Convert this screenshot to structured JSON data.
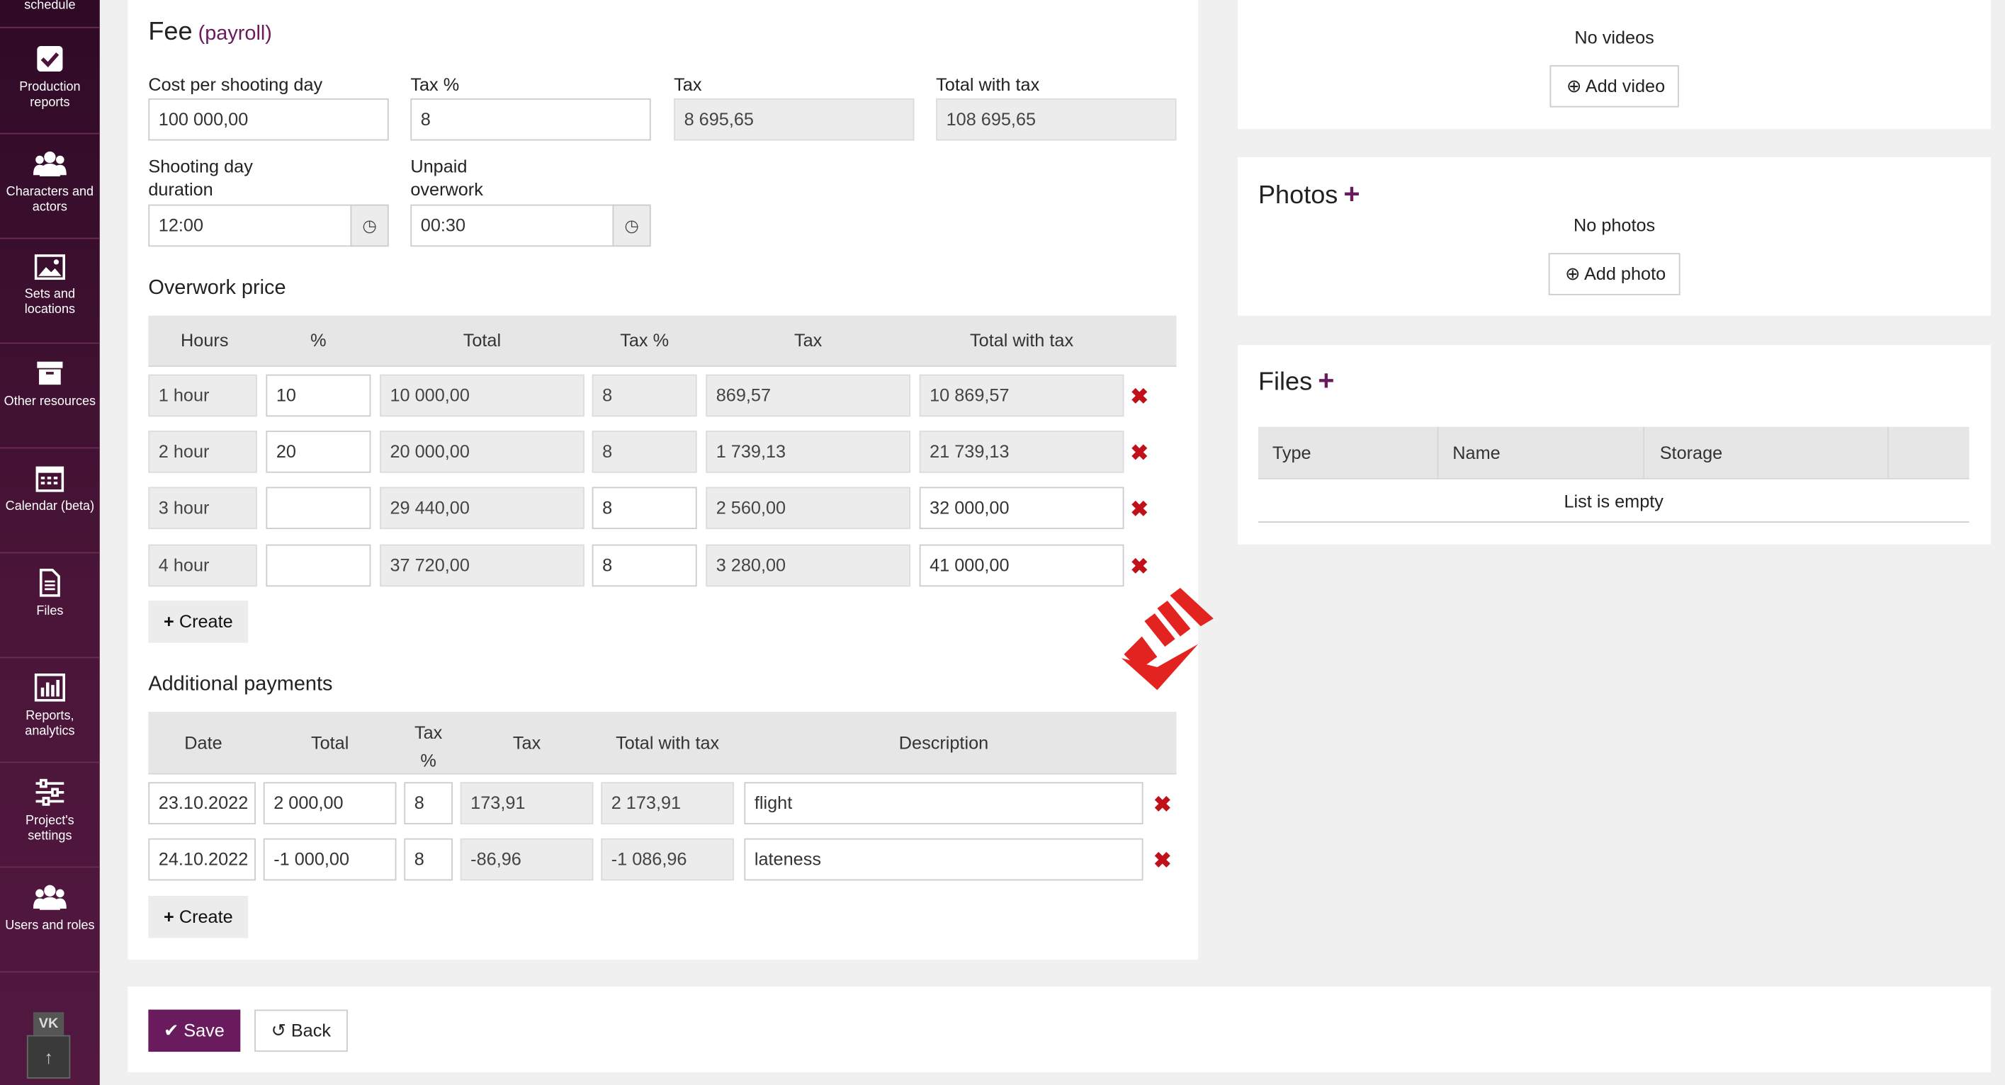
{
  "sidebar": {
    "top_label": "schedule",
    "items": [
      {
        "label": "Production reports",
        "icon": "checkbox-icon"
      },
      {
        "label": "Characters and actors",
        "icon": "users-icon"
      },
      {
        "label": "Sets and locations",
        "icon": "image-icon"
      },
      {
        "label": "Other resources",
        "icon": "archive-icon"
      },
      {
        "label": "Calendar (beta)",
        "icon": "calendar-icon"
      },
      {
        "label": "Files",
        "icon": "document-icon"
      },
      {
        "label": "Reports, analytics",
        "icon": "bar-chart-icon"
      },
      {
        "label": "Project's settings",
        "icon": "sliders-icon"
      },
      {
        "label": "Users and roles",
        "icon": "users-icon"
      }
    ],
    "vk_label": "VK",
    "scroll_top_label": "↑"
  },
  "fee": {
    "title": "Fee",
    "subtitle": "(payroll)",
    "cost_label": "Cost per shooting day",
    "cost_value": "100 000,00",
    "tax_pct_label": "Tax %",
    "tax_pct_value": "8",
    "tax_label": "Tax",
    "tax_value": "8 695,65",
    "total_label": "Total with tax",
    "total_value": "108 695,65",
    "duration_label_1": "Shooting day",
    "duration_label_2": "duration",
    "duration_value": "12:00",
    "unpaid_label_1": "Unpaid",
    "unpaid_label_2": "overwork",
    "unpaid_value": "00:30"
  },
  "overwork": {
    "title": "Overwork price",
    "headers": [
      "Hours",
      "%",
      "Total",
      "Tax %",
      "Tax",
      "Total with tax"
    ],
    "rows": [
      {
        "hours": "1 hour",
        "pct": "10",
        "total": "10 000,00",
        "tax_pct": "8",
        "tax": "869,57",
        "total_tax": "10 869,57"
      },
      {
        "hours": "2 hour",
        "pct": "20",
        "total": "20 000,00",
        "tax_pct": "8",
        "tax": "1 739,13",
        "total_tax": "21 739,13"
      },
      {
        "hours": "3 hour",
        "pct": "",
        "total": "29 440,00",
        "tax_pct": "8",
        "tax": "2 560,00",
        "total_tax": "32 000,00"
      },
      {
        "hours": "4 hour",
        "pct": "",
        "total": "37 720,00",
        "tax_pct": "8",
        "tax": "3 280,00",
        "total_tax": "41 000,00"
      }
    ],
    "create_label": "Create",
    "delete_glyph": "✖"
  },
  "additional": {
    "title": "Additional payments",
    "headers": {
      "date": "Date",
      "total": "Total",
      "tax_pct_1": "Tax",
      "tax_pct_2": "%",
      "tax": "Tax",
      "total_tax": "Total with tax",
      "description": "Description"
    },
    "rows": [
      {
        "date": "23.10.2022",
        "total": "2 000,00",
        "tax_pct": "8",
        "tax": "173,91",
        "total_tax": "2 173,91",
        "description": "flight"
      },
      {
        "date": "24.10.2022",
        "total": "-1 000,00",
        "tax_pct": "8",
        "tax": "-86,96",
        "total_tax": "-1 086,96",
        "description": "lateness"
      }
    ],
    "create_label": "Create"
  },
  "videos": {
    "empty_text": "No videos",
    "add_label": "Add video"
  },
  "photos": {
    "title": "Photos",
    "empty_text": "No photos",
    "add_label": "Add photo"
  },
  "files": {
    "title": "Files",
    "headers": [
      "Type",
      "Name",
      "Storage"
    ],
    "empty_text": "List is empty"
  },
  "footer": {
    "save_label": "Save",
    "back_label": "Back"
  },
  "colors": {
    "accent": "#6a1b5e",
    "delete": "#c0101a",
    "sidebar": "#4a1538",
    "logo": "#e3231f"
  }
}
